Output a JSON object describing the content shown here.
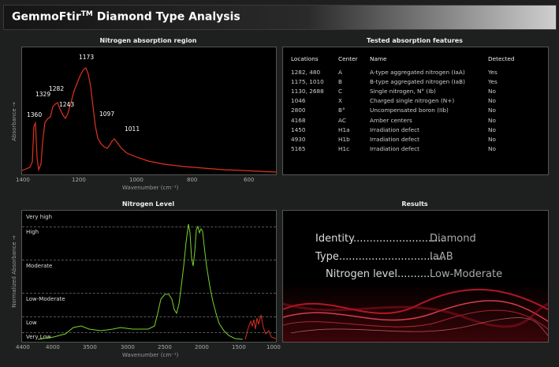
{
  "app": {
    "title": "GemmoFtir",
    "trademark": "TM",
    "subtitle": "Diamond Type Analysis"
  },
  "panels": {
    "absorption_title": "Nitrogen absorption region",
    "features_title": "Tested absorption features",
    "level_title": "Nitrogen Level",
    "results_title": "Results"
  },
  "absorption_chart": {
    "ylabel": "Absorbance →",
    "xlabel": "Wavenumber (cm⁻¹)",
    "xticks": [
      "1400",
      "1200",
      "1000",
      "800",
      "600"
    ],
    "peaks": [
      "1360",
      "1329",
      "1282",
      "1243",
      "1173",
      "1097",
      "1011"
    ]
  },
  "features_table": {
    "headers": [
      "Locations",
      "Center",
      "Name",
      "Detected"
    ],
    "rows": [
      [
        "1282,  480",
        "A",
        "A-type aggregated nitrogen (IaA)",
        "Yes"
      ],
      [
        "1175, 1010",
        "B",
        "B-type aggregated nitrogen (IaB)",
        "Yes"
      ],
      [
        "1130, 2688",
        "C",
        "Single nitrogen, N° (Ib)",
        "No"
      ],
      [
        "1046",
        "X",
        "Charged single nitrogen (N+)",
        "No"
      ],
      [
        "2800",
        "B°",
        "Uncompensated boron (IIb)",
        "No"
      ],
      [
        "4168",
        "AC",
        "Amber centers",
        "No"
      ],
      [
        "1450",
        "H1a",
        "Irradiation defect",
        "No"
      ],
      [
        "4930",
        "H1b",
        "Irradiation defect",
        "No"
      ],
      [
        "5165",
        "H1c",
        "Irradiation defect",
        "No"
      ]
    ]
  },
  "level_chart": {
    "ylabel": "Normalized  Absorbance →",
    "xlabel": "Wavenumber (cm⁻¹)",
    "levels": [
      "Very high",
      "High",
      "Moderate",
      "Low-Moderate",
      "Low",
      "Very Low"
    ],
    "xticks": [
      "4400",
      "4000",
      "3500",
      "3000",
      "2500",
      "2000",
      "1500",
      "1000"
    ]
  },
  "results": {
    "identity_label": "Identity............................",
    "identity_value": "Diamond",
    "type_label": "Type.................................",
    "type_value": "IaAB",
    "nitrogen_label": "Nitrogen level..........",
    "nitrogen_value": "Low-Moderate"
  },
  "colors": {
    "absorption_line": "#e0321e",
    "level_line": "#7ad32a",
    "level_red": "#d9301c"
  }
}
